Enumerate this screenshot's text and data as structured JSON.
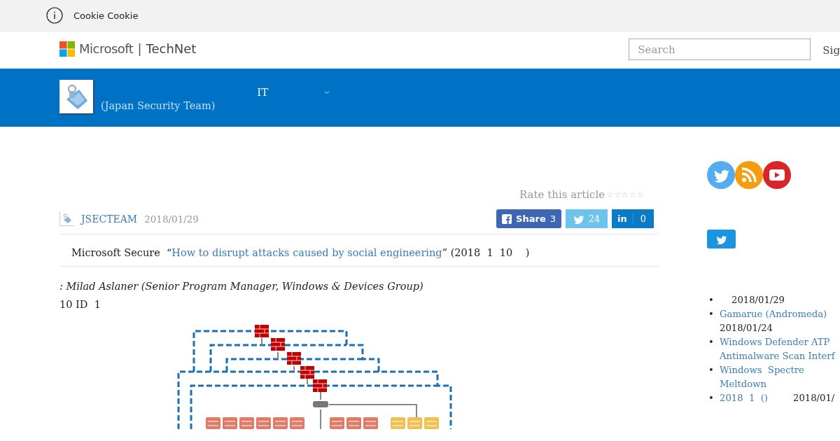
{
  "cookie_bar": {
    "text": "Cookie Cookie"
  },
  "header": {
    "brand": "Microsoft",
    "separator": "|",
    "site": "TechNet",
    "search": {
      "placeholder": "Search"
    },
    "sign_in": "Sig"
  },
  "banner": {
    "subtitle": "(Japan Security Team)",
    "nav": [
      {
        "label": "IT",
        "expanded": false
      }
    ]
  },
  "article": {
    "rating": {
      "label": "Rate this article",
      "stars": 0
    },
    "author": "JSECTEAM",
    "date": "2018/01/29",
    "share": {
      "facebook": {
        "label": "Share",
        "count": "3"
      },
      "twitter": {
        "count": "24"
      },
      "linkedin": {
        "label": "in",
        "count": "0"
      }
    },
    "intro": {
      "before": "Microsoft Secure  “",
      "link": "How to disrupt attacks caused by social engineering",
      "after": "” (2018  1  10    )"
    },
    "byline": ": Milad Aslaner (Senior Program Manager, Windows & Devices Group)",
    "paragraph": "10 ID  1"
  },
  "sidebar": {
    "recent_posts": [
      {
        "marker": "•",
        "kind": "date-only",
        "date": "2018/01/29"
      },
      {
        "marker": "•",
        "kind": "date-below",
        "link": "Gamarue (Andromeda)",
        "date": "2018/01/24"
      },
      {
        "marker": "•",
        "kind": "link-only",
        "link": "Windows Defender ATP\nAntimalware Scan Interf"
      },
      {
        "marker": "•",
        "kind": "link-only",
        "link": "Windows  Spectre\nMeltdown"
      },
      {
        "marker": "•",
        "kind": "date-inline",
        "link": "2018  1  ()",
        "date": "2018/01/"
      }
    ]
  }
}
